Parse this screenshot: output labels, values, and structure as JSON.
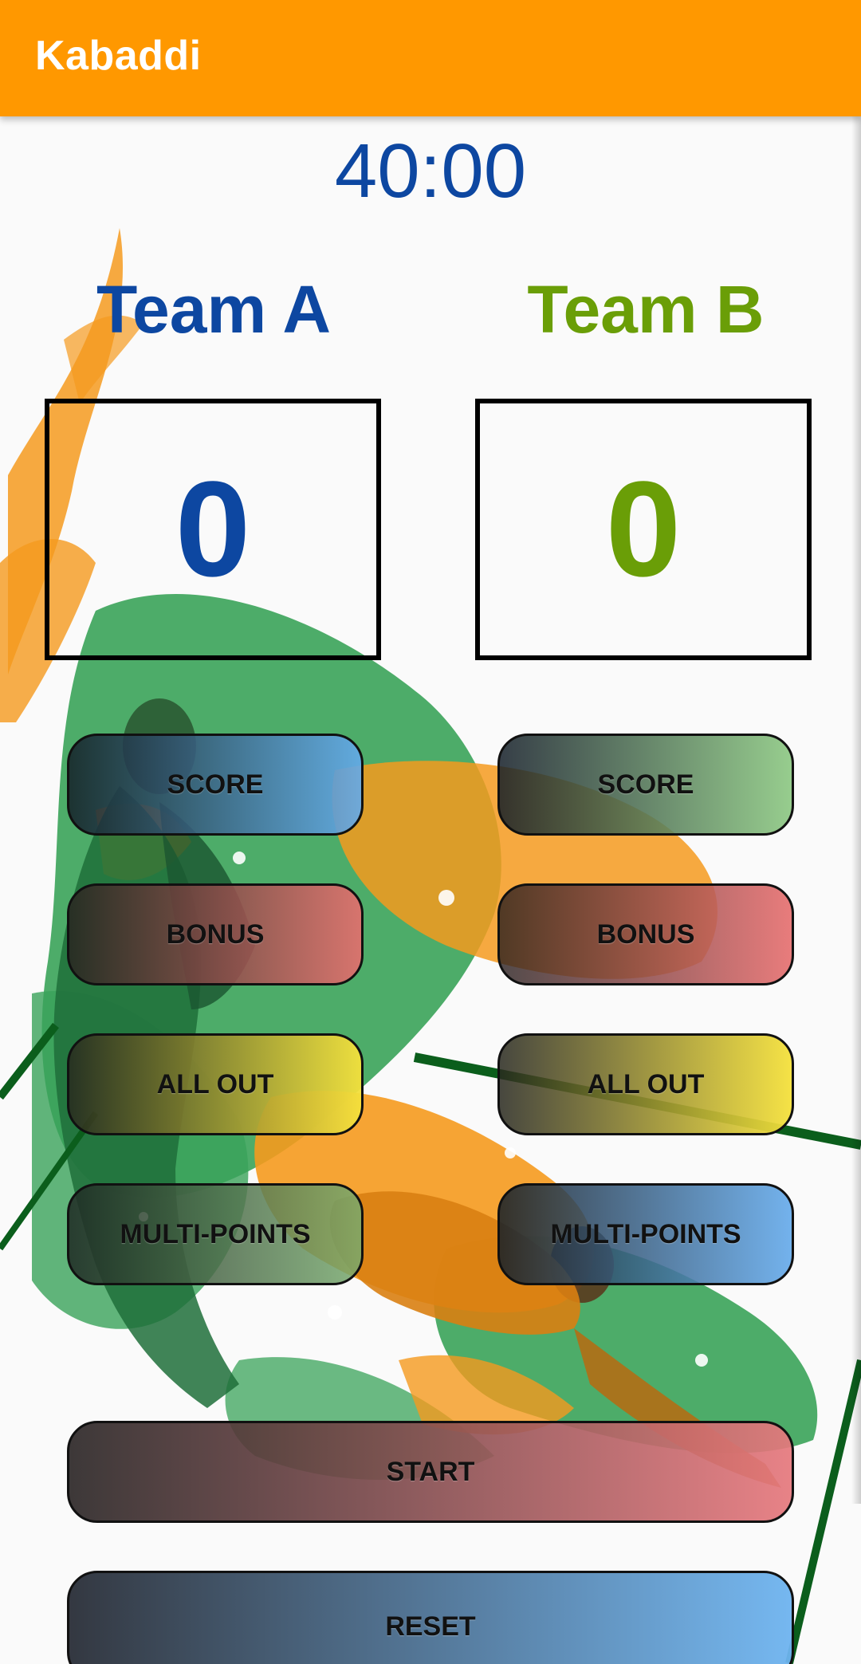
{
  "app": {
    "title": "Kabaddi",
    "colors": {
      "appbar": "#ff9800",
      "team_a": "#0d47a1",
      "team_b": "#6a9e07",
      "timer": "#0d47a1"
    }
  },
  "timer": {
    "value": "40:00"
  },
  "teams": {
    "a": {
      "name": "Team A",
      "score": "0",
      "buttons": {
        "score": "SCORE",
        "bonus": "BONUS",
        "all_out": "ALL OUT",
        "multi_points": "MULTI-POINTS"
      }
    },
    "b": {
      "name": "Team B",
      "score": "0",
      "buttons": {
        "score": "SCORE",
        "bonus": "BONUS",
        "all_out": "ALL OUT",
        "multi_points": "MULTI-POINTS"
      }
    }
  },
  "controls": {
    "start": "START",
    "reset": "RESET"
  },
  "background": {
    "description_icon": "kabaddi-players-artwork"
  }
}
